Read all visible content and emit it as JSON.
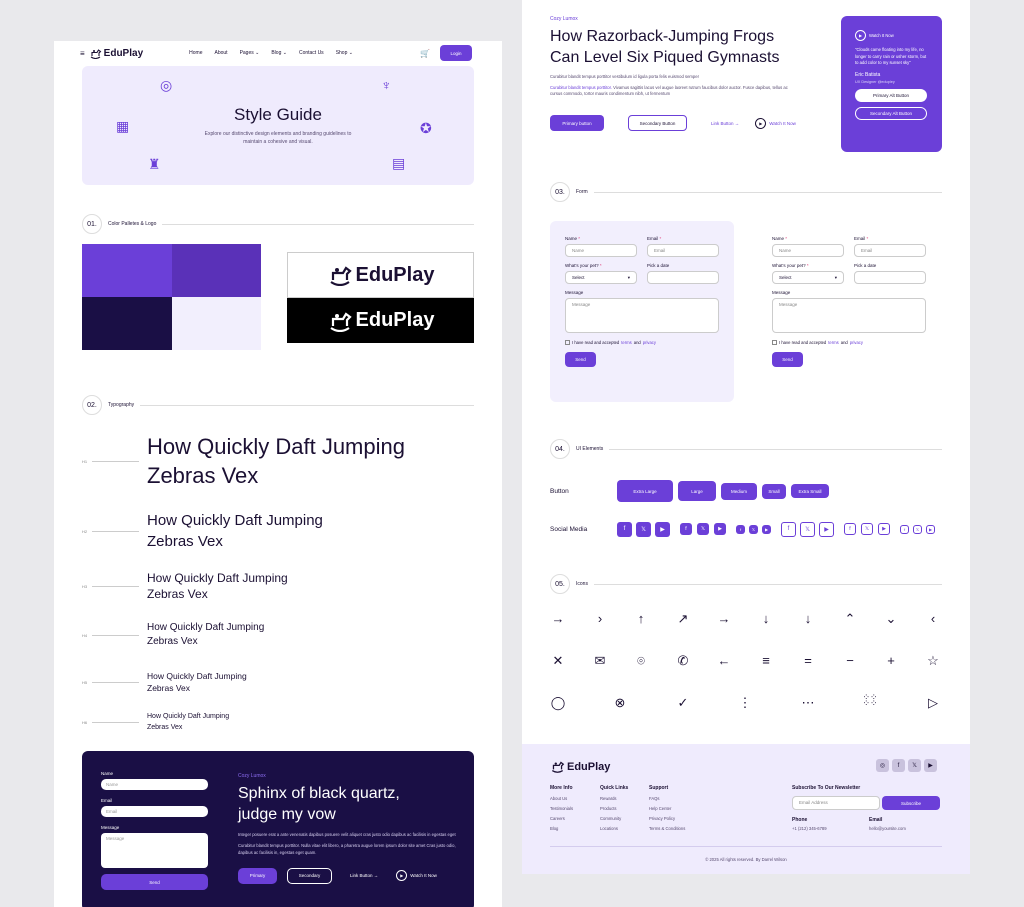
{
  "nav": {
    "logo": "EduPlay",
    "links": [
      "Home",
      "About",
      "Pages",
      "Blog",
      "Contact Us",
      "Shop"
    ],
    "login": "Login"
  },
  "hero": {
    "title": "Style Guide",
    "desc": "Explore our distinctive design elements and branding guidelines to maintain a cohesive and visual."
  },
  "sections": {
    "s1": {
      "num": "01.",
      "label": "Color Palletes & Logo"
    },
    "s2": {
      "num": "02.",
      "label": "Typography"
    },
    "s3": {
      "num": "03.",
      "label": "Form"
    },
    "s4": {
      "num": "04.",
      "label": "UI Elements"
    },
    "s5": {
      "num": "05.",
      "label": "Icons"
    }
  },
  "colors": [
    "#6b3fd8",
    "#5a31b8",
    "#1a0f45",
    "#f2effd"
  ],
  "logo_text": "EduPlay",
  "typography": [
    {
      "tag": "H1",
      "line1": "How Quickly Daft Jumping",
      "line2": "Zebras Vex"
    },
    {
      "tag": "H2",
      "line1": "How Quickly Daft Jumping",
      "line2": "Zebras Vex"
    },
    {
      "tag": "H3",
      "line1": "How Quickly Daft Jumping",
      "line2": "Zebras Vex"
    },
    {
      "tag": "H4",
      "line1": "How Quickly Daft Jumping",
      "line2": "Zebras Vex"
    },
    {
      "tag": "H5",
      "line1": "How Quickly Daft Jumping",
      "line2": "Zebras Vex"
    },
    {
      "tag": "H6",
      "line1": "How Quickly Daft Jumping",
      "line2": "Zebras Vex"
    }
  ],
  "dark": {
    "name_label": "Name",
    "name_ph": "Name",
    "email_label": "Email",
    "email_ph": "Email",
    "msg_label": "Message",
    "msg_ph": "Message",
    "send": "Send",
    "eyebrow": "Cozy Lumox",
    "title": "Sphinx of black quartz, judge my vow",
    "p1": "Integer posuere erat a ante venenatis dapibus posuere velit aliquet cras justo odio dapibus ac facilisis in egestas eget",
    "p2": "Curabitur blandit tempus porttitor. Nulla vitae elit libero, a pharetra augue lorem ipsum dolor site amet Cras justo odio, dapibus ac facilisis in, egestas eget quam.",
    "primary": "Primary",
    "secondary": "Secondary",
    "link": "Link Button →",
    "watch": "Watch It Now"
  },
  "top": {
    "eyebrow": "Cozy Lumox",
    "title_l1": "How Razorback-Jumping Frogs",
    "title_l2": "Can Level Six Piqued Gymnasts",
    "p1": "Curabitur blandit tempus porttitor vestibulum id ligula porta felis euismod semper",
    "p2_link": "Curabitur blandit tempus porttitor.",
    "p2": " Vivamus sagittis lacus vel augue laoreet rutrum faucibus dolor auctor. Fusce dapibus, tellus ac cursus commodo, tortor mauris condimentum nibh, ut fermentum",
    "primary": "Primary button",
    "secondary": "Secondary Button",
    "link": "Link Button →",
    "watch": "Watch It Now",
    "card": {
      "watch": "Watch It Now",
      "quote": "\"Clouds came floating into my life, no longer to carry rain or usher storm, but to add color to my sunset sky\"",
      "name": "Eric Batista",
      "role": "UX Designer @edupley",
      "primary": "Primary Alt Button",
      "secondary": "Secondary Alt Button"
    }
  },
  "form": {
    "name_label": "Name",
    "name_ph": "Name",
    "email_label": "Email",
    "email_ph": "Email",
    "pet_label": "What's your pet?",
    "pet_value": "Select",
    "date_label": "Pick a date",
    "msg_label": "Message",
    "msg_ph": "Message",
    "agree_pre": "I have read and accepted ",
    "terms": "terms",
    "and": " and ",
    "privacy": "privacy",
    "send": "Send"
  },
  "ui": {
    "button_label": "Button",
    "sizes": [
      "Extra Large",
      "Large",
      "Medium",
      "Small",
      "Extra Small"
    ],
    "social_label": "Social Media"
  },
  "footer": {
    "logo": "EduPlay",
    "cols": [
      {
        "title": "More Info",
        "items": [
          "About Us",
          "Testimonials",
          "Careers",
          "Blog"
        ]
      },
      {
        "title": "Quick Links",
        "items": [
          "Rewards",
          "Products",
          "Community",
          "Locations"
        ]
      },
      {
        "title": "Support",
        "items": [
          "FAQs",
          "Help Center",
          "Privacy Policy",
          "Terms & Conditions"
        ]
      }
    ],
    "newsletter": "Subscribe To Our Newsletter",
    "email_ph": "Email Address",
    "subscribe": "Subscribe",
    "phone_label": "Phone",
    "phone": "+1 (212) 345-6789",
    "email_label": "Email",
    "email": "hello@yoursite.com",
    "copyright": "© 2025 All rights reserved. By Darrel Wilson"
  }
}
